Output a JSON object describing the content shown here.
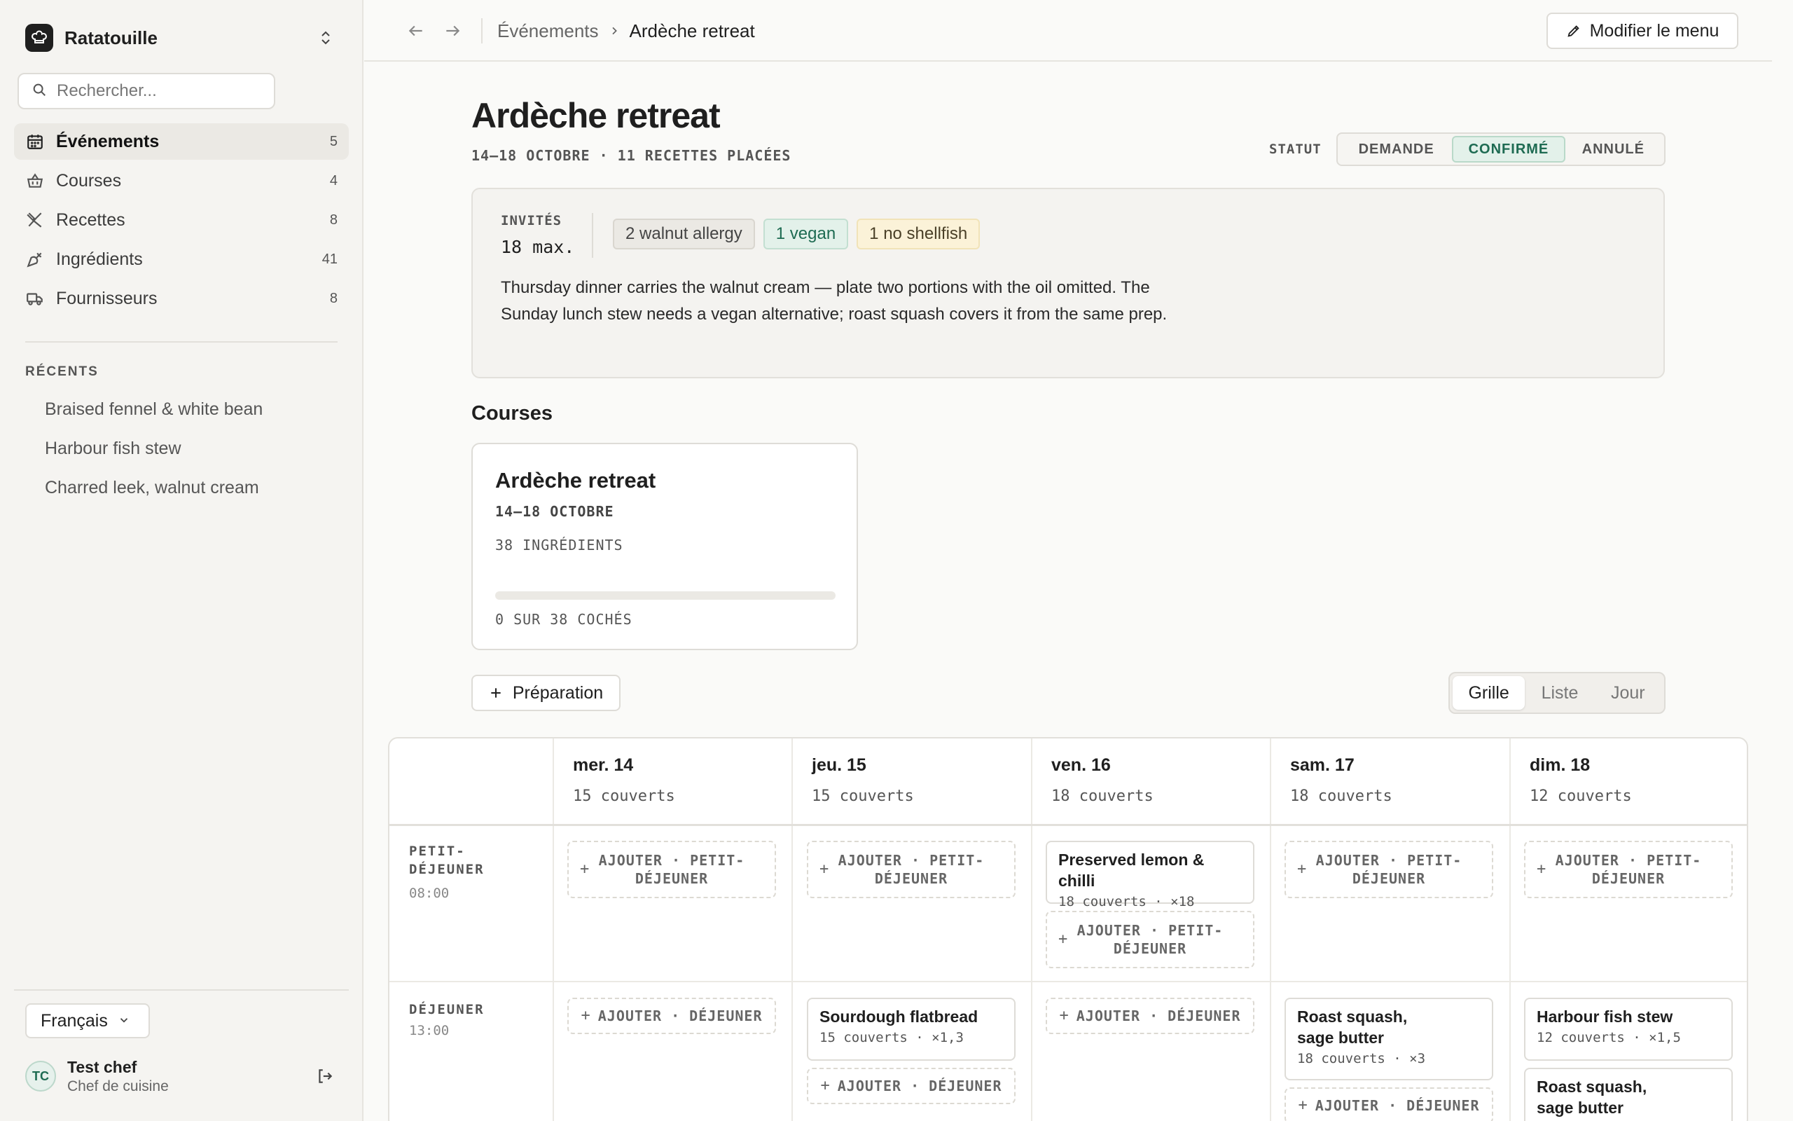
{
  "sidebar": {
    "workspace": "Ratatouille",
    "search_placeholder": "Rechercher...",
    "nav": [
      {
        "label": "Événements",
        "count": "5"
      },
      {
        "label": "Courses",
        "count": "4"
      },
      {
        "label": "Recettes",
        "count": "8"
      },
      {
        "label": "Ingrédients",
        "count": "41"
      },
      {
        "label": "Fournisseurs",
        "count": "8"
      }
    ],
    "recents_title": "RÉCENTS",
    "recents": [
      "Braised fennel & white bean",
      "Harbour fish stew",
      "Charred leek, walnut cream"
    ],
    "language": "Français",
    "user": {
      "initials": "TC",
      "name": "Test chef",
      "role": "Chef de cuisine"
    }
  },
  "topbar": {
    "breadcrumb": [
      "Événements",
      "Ardèche retreat"
    ],
    "edit_label": "Modifier le menu"
  },
  "header": {
    "title": "Ardèche retreat",
    "subtitle": "14–18 OCTOBRE · 11 RECETTES PLACÉES",
    "status_label": "STATUT",
    "status_options": [
      "DEMANDE",
      "CONFIRMÉ",
      "ANNULÉ"
    ],
    "status_selected": "CONFIRMÉ"
  },
  "guests": {
    "label": "INVITÉS",
    "value": "18 max.",
    "tags": [
      "2 walnut allergy",
      "1 vegan",
      "1 no shellfish"
    ],
    "notes": "Thursday dinner carries the walnut cream — plate two portions with the oil omitted. The Sunday lunch stew needs a vegan alternative; roast squash covers it from the same prep."
  },
  "courses": {
    "heading": "Courses",
    "card": {
      "title": "Ardèche retreat",
      "date": "14–18 OCTOBRE",
      "ingredients": "38 INGRÉDIENTS",
      "checked_text": "0 SUR 38 COCHÉS",
      "progress": 0
    }
  },
  "toolbar": {
    "prep_label": "Préparation",
    "views": [
      "Grille",
      "Liste",
      "Jour"
    ],
    "view_selected": "Grille"
  },
  "grid": {
    "days": [
      {
        "name": "mer. 14",
        "covers": "15 couverts"
      },
      {
        "name": "jeu. 15",
        "covers": "15 couverts"
      },
      {
        "name": "ven. 16",
        "covers": "18 couverts"
      },
      {
        "name": "sam. 17",
        "covers": "18 couverts"
      },
      {
        "name": "dim. 18",
        "covers": "12 couverts"
      }
    ],
    "meals": [
      {
        "name_line1": "PETIT-",
        "name_line2": "DÉJEUNER",
        "time": "08:00",
        "add_line1": "AJOUTER · PETIT-",
        "add_line2": "DÉJEUNER"
      },
      {
        "name_line1": "DÉJEUNER",
        "time": "13:00",
        "add_label": "AJOUTER · DÉJEUNER"
      }
    ],
    "recipes": {
      "fri_breakfast": {
        "name": "Preserved lemon & chilli",
        "meta": "18 couverts · ×18"
      },
      "thu_lunch": {
        "name": "Sourdough flatbread",
        "meta": "15 couverts · ×1,3"
      },
      "sat_lunch": {
        "name_line1": "Roast squash,",
        "name_line2": "sage butter",
        "meta": "18 couverts · ×3"
      },
      "sun_lunch_1": {
        "name": "Harbour fish stew",
        "meta": "12 couverts · ×1,5"
      },
      "sun_lunch_2": {
        "name_line1": "Roast squash,",
        "name_line2": "sage butter"
      }
    }
  }
}
